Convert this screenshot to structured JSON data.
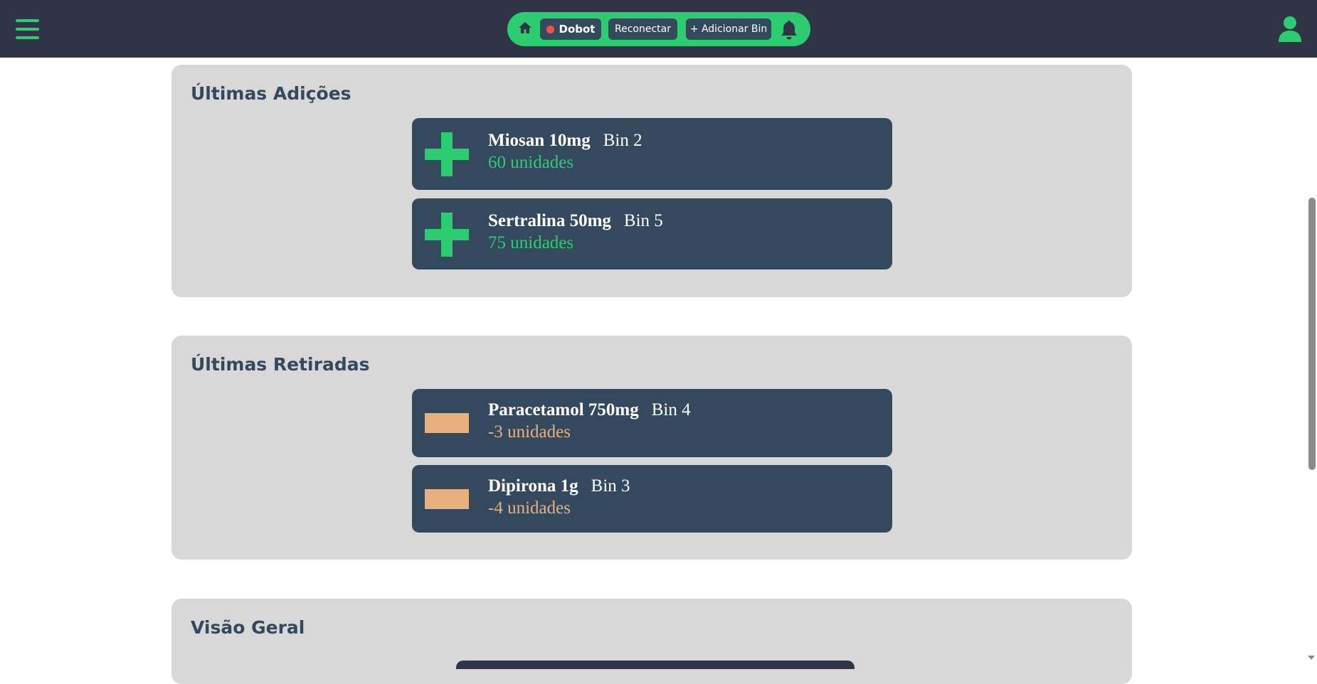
{
  "header": {
    "robot_name": "Dobot",
    "robot_status_color": "#ff4d4d",
    "reconnect_label": "Reconectar",
    "add_bin_label": "+ Adicionar Bin",
    "icons": [
      "menu-icon",
      "home-icon",
      "bell-icon",
      "user-icon"
    ]
  },
  "colors": {
    "accent": "#2ecc71",
    "card_bg": "#34495e",
    "removal": "#e8b07e",
    "section_bg": "#d9d8d9"
  },
  "additions": {
    "title": "Últimas Adições",
    "items": [
      {
        "name": "Miosan 10mg",
        "bin": "Bin 2",
        "qty": "60 unidades"
      },
      {
        "name": "Sertralina 50mg",
        "bin": "Bin 5",
        "qty": "75 unidades"
      }
    ]
  },
  "removals": {
    "title": "Últimas Retiradas",
    "items": [
      {
        "name": "Paracetamol 750mg",
        "bin": "Bin 4",
        "qty": "-3 unidades"
      },
      {
        "name": "Dipirona 1g",
        "bin": "Bin 3",
        "qty": "-4 unidades"
      }
    ]
  },
  "overview": {
    "title": "Visão Geral"
  }
}
